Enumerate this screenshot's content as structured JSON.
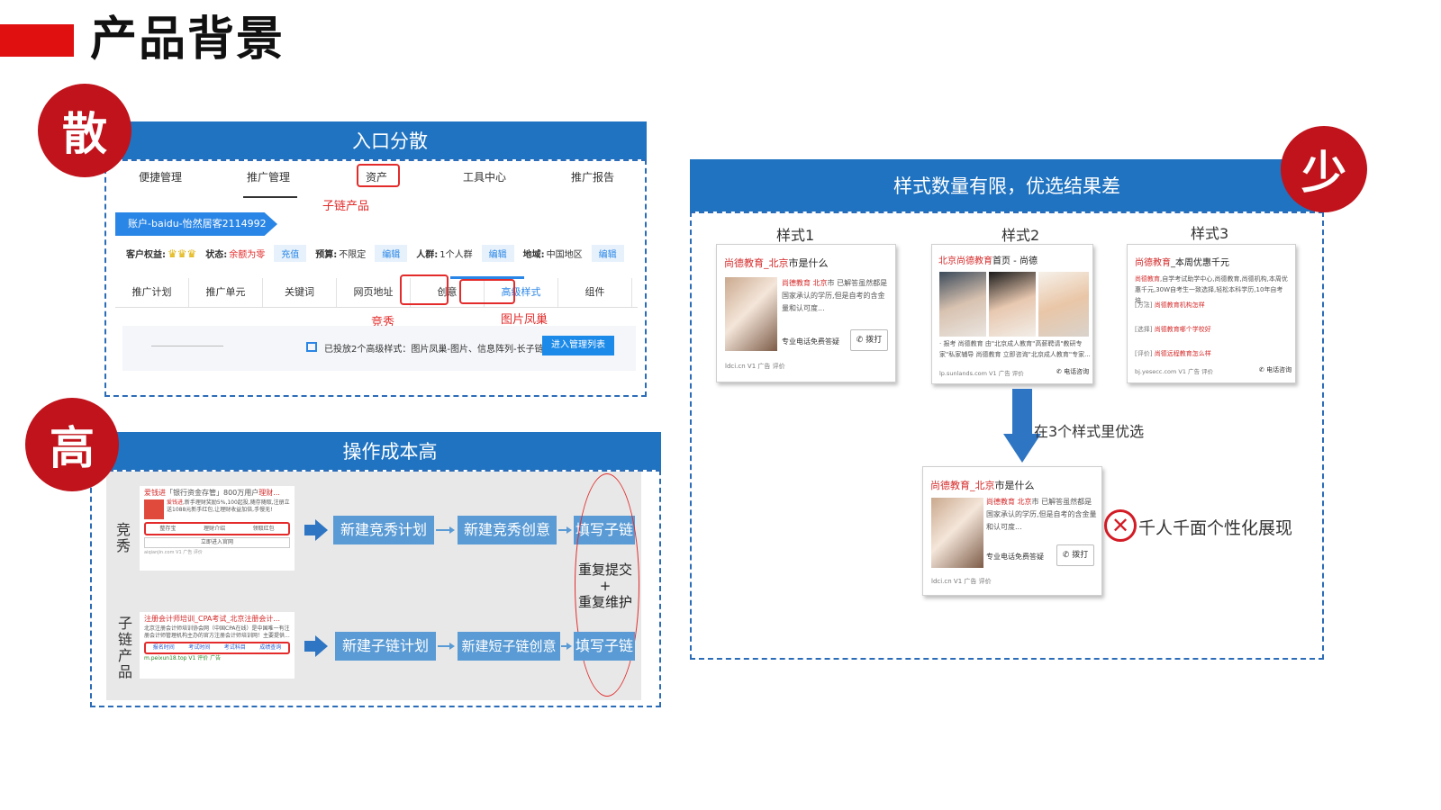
{
  "page": {
    "title": "产品背景"
  },
  "badges": {
    "scatter": "散",
    "high": "高",
    "few": "少"
  },
  "panel_entry": {
    "header": "入口分散",
    "tabs": [
      "便捷管理",
      "推广管理",
      "资产",
      "工具中心",
      "推广报告"
    ],
    "annot_sublink": "子链产品",
    "account": "账户-baidu-怡然居客2114992",
    "info": {
      "rights_label": "客户权益:",
      "status_label": "状态:",
      "status_value": "余额为零",
      "recharge": "充值",
      "budget_label": "预算:",
      "budget_value": "不限定",
      "edit1": "编辑",
      "audience_label": "人群:",
      "audience_value": "1个人群",
      "edit2": "编辑",
      "region_label": "地域:",
      "region_value": "中国地区",
      "edit3": "编辑"
    },
    "subtabs": [
      "推广计划",
      "推广单元",
      "关键词",
      "网页地址",
      "创意",
      "高级样式",
      "组件"
    ],
    "annot_showcase": "竞秀",
    "annot_phoenix": "图片凤巢",
    "notice": "已投放2个高级样式：图片凤巢-图片、信息阵列-长子链",
    "manage_button": "进入管理列表"
  },
  "panel_cost": {
    "header": "操作成本高",
    "row1": {
      "label": "竞秀",
      "ad": {
        "title_red": "爱钱进",
        "title_rest": "「银行资金存管」800万用户",
        "title_tail": "理财...",
        "desc_red": "爱钱进",
        "desc": ",新手理财奖励5%,100起投,随存随取,注册立送1088元新手红包,让理财收益加倍,手慢无!",
        "buttons": [
          "整存宝",
          "理财介绍",
          "领取红包"
        ],
        "cta": "立即进入官网",
        "url": "aiqianjin.com  V1  广告  评价"
      },
      "steps": [
        "新建竞秀计划",
        "新建竞秀创意",
        "填写子链"
      ]
    },
    "repeat_top": "重复提交",
    "repeat_plus": "+",
    "repeat_bottom": "重复维护",
    "row2": {
      "label": "子链产品",
      "ad": {
        "title": "注册会计师培训_CPA考试_北京注册会计...",
        "desc": "北京注册会计师培训协会网（中国CPA在线）是中国唯一有注册会计师管理机构主办的官方注册会计师培训网！主要提供...",
        "links": [
          "报名时间",
          "考试时间",
          "考试科目",
          "成绩查询"
        ],
        "url": "m.peixun18.top  V1  评价  广告"
      },
      "steps": [
        "新建子链计划",
        "新建短子链创意",
        "填写子链"
      ]
    }
  },
  "panel_styles": {
    "header": "样式数量有限，优选结果差",
    "style_labels": [
      "样式1",
      "样式2",
      "样式3"
    ],
    "card1": {
      "title_red": "尚德教育_北京",
      "title_rest": "市是什么",
      "desc_red": "尚德教育 北京",
      "desc": "市 已解答虽然都是国家承认的学历,但是自考的含金量和认可度...",
      "phone": "专业电话免费答疑",
      "call": "拨打",
      "url": "ldci.cn  V1  广告  评价"
    },
    "card2": {
      "title_red": "北京尚德教育",
      "title_rest": "首页 - 尚德",
      "desc": "· 报考 尚德教育 由\"北京成人教育\"高薪聘请\"教研专家\"私家辅导 尚德教育 立即咨询\"北京成人教育\"专家...",
      "url": "lp.sunlands.com  V1  广告  评价",
      "call": "电话咨询"
    },
    "card3": {
      "title_red": "尚德教育",
      "title_rest": "_本周优惠千元",
      "desc_red": "尚德教育",
      "desc": ",自学考试助学中心,尚德教育,尚德机构,本周优惠千元,30W自考生一致选择,轻松本科学历,10年自考培...",
      "link1_prefix": "[方法]",
      "link1": "尚德教育机构怎样",
      "link2_prefix": "[选择]",
      "link2": "尚德教育哪个学校好",
      "link3_prefix": "[评价]",
      "link3": "尚德远程教育怎么样",
      "url": "bj.yesecc.com  V1  广告  评价",
      "call": "电话咨询"
    },
    "select_note": "在3个样式里优选",
    "result_card": {
      "title_red": "尚德教育_北京",
      "title_rest": "市是什么",
      "desc_red": "尚德教育 北京",
      "desc": "市 已解答虽然都是国家承认的学历,但是自考的含金量和认可度...",
      "phone": "专业电话免费答疑",
      "call": "拨打",
      "url": "ldci.cn  V1  广告  评价"
    },
    "personalization": "千人千面个性化展现"
  },
  "colors": {
    "brand_blue": "#1f73c1",
    "accent_red": "#c0131b",
    "flow_blue": "#5a9bd5"
  }
}
